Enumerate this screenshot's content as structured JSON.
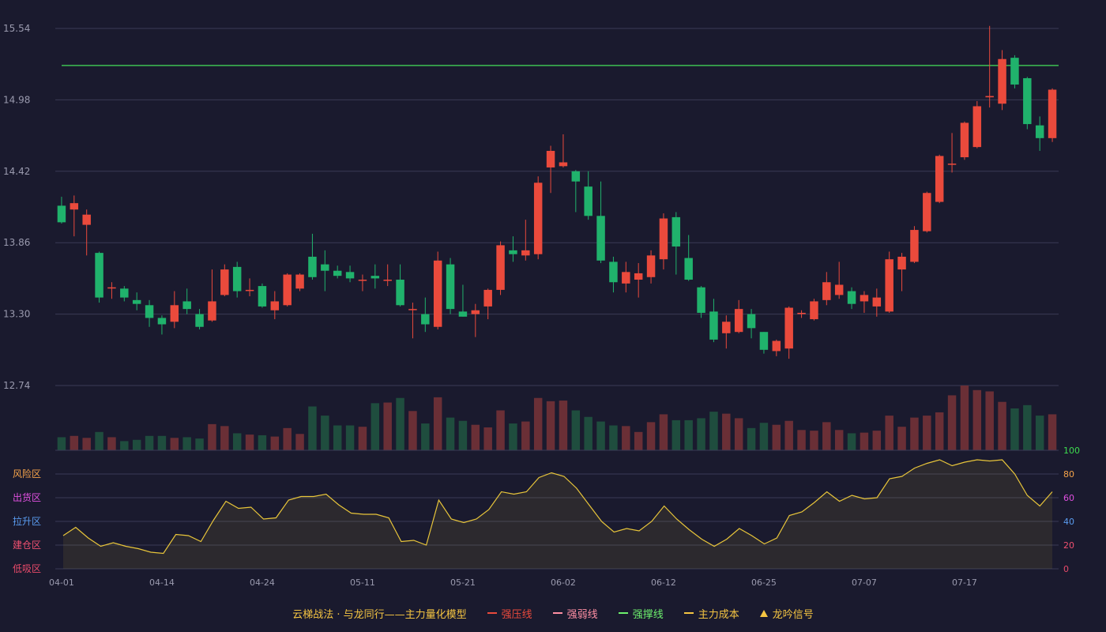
{
  "chart_data": {
    "type": "candlestick",
    "price_axis": {
      "ylim": [
        12.74,
        15.54
      ],
      "ticks": [
        "15.54",
        "14.98",
        "14.42",
        "13.86",
        "13.30",
        "12.74"
      ]
    },
    "reference_line": {
      "value": 15.25,
      "color": "#3cbf52"
    },
    "x_ticks": [
      {
        "i": 0,
        "label": "04-01"
      },
      {
        "i": 8,
        "label": "04-14"
      },
      {
        "i": 16,
        "label": "04-24"
      },
      {
        "i": 24,
        "label": "05-11"
      },
      {
        "i": 32,
        "label": "05-21"
      },
      {
        "i": 40,
        "label": "06-02"
      },
      {
        "i": 48,
        "label": "06-12"
      },
      {
        "i": 56,
        "label": "06-25"
      },
      {
        "i": 64,
        "label": "07-07"
      },
      {
        "i": 72,
        "label": "07-17"
      }
    ],
    "candles": [
      [
        14.15,
        14.02,
        14.22,
        14.01
      ],
      [
        14.12,
        14.17,
        14.23,
        13.91
      ],
      [
        14.0,
        14.08,
        14.12,
        13.76
      ],
      [
        13.78,
        13.43,
        13.79,
        13.39
      ],
      [
        13.51,
        13.51,
        13.55,
        13.42
      ],
      [
        13.5,
        13.43,
        13.52,
        13.4
      ],
      [
        13.41,
        13.38,
        13.47,
        13.33
      ],
      [
        13.37,
        13.27,
        13.41,
        13.2
      ],
      [
        13.27,
        13.22,
        13.29,
        13.14
      ],
      [
        13.24,
        13.37,
        13.48,
        13.19
      ],
      [
        13.4,
        13.34,
        13.5,
        13.3
      ],
      [
        13.3,
        13.2,
        13.34,
        13.18
      ],
      [
        13.25,
        13.4,
        13.65,
        13.24
      ],
      [
        13.45,
        13.65,
        13.69,
        13.44
      ],
      [
        13.67,
        13.48,
        13.71,
        13.43
      ],
      [
        13.49,
        13.49,
        13.58,
        13.44
      ],
      [
        13.52,
        13.36,
        13.54,
        13.35
      ],
      [
        13.33,
        13.4,
        13.48,
        13.26
      ],
      [
        13.37,
        13.61,
        13.62,
        13.36
      ],
      [
        13.5,
        13.61,
        13.62,
        13.48
      ],
      [
        13.75,
        13.59,
        13.93,
        13.57
      ],
      [
        13.69,
        13.64,
        13.8,
        13.48
      ],
      [
        13.64,
        13.6,
        13.68,
        13.58
      ],
      [
        13.63,
        13.58,
        13.68,
        13.55
      ],
      [
        13.57,
        13.57,
        13.61,
        13.48
      ],
      [
        13.6,
        13.58,
        13.69,
        13.5
      ],
      [
        13.57,
        13.57,
        13.69,
        13.52
      ],
      [
        13.57,
        13.37,
        13.69,
        13.36
      ],
      [
        13.34,
        13.34,
        13.39,
        13.11
      ],
      [
        13.3,
        13.22,
        13.43,
        13.16
      ],
      [
        13.2,
        13.72,
        13.79,
        13.18
      ],
      [
        13.69,
        13.34,
        13.74,
        13.3
      ],
      [
        13.32,
        13.28,
        13.53,
        13.28
      ],
      [
        13.3,
        13.33,
        13.38,
        13.12
      ],
      [
        13.36,
        13.49,
        13.5,
        13.26
      ],
      [
        13.49,
        13.84,
        13.87,
        13.45
      ],
      [
        13.8,
        13.77,
        13.91,
        13.71
      ],
      [
        13.76,
        13.8,
        14.04,
        13.72
      ],
      [
        13.77,
        14.33,
        14.38,
        13.73
      ],
      [
        14.45,
        14.58,
        14.62,
        14.25
      ],
      [
        14.46,
        14.49,
        14.71,
        14.45
      ],
      [
        14.42,
        14.34,
        14.43,
        14.1
      ],
      [
        14.3,
        14.07,
        14.42,
        14.04
      ],
      [
        14.07,
        13.72,
        14.34,
        13.7
      ],
      [
        13.71,
        13.55,
        13.75,
        13.47
      ],
      [
        13.54,
        13.63,
        13.71,
        13.47
      ],
      [
        13.57,
        13.62,
        13.7,
        13.43
      ],
      [
        13.59,
        13.76,
        13.8,
        13.54
      ],
      [
        13.73,
        14.05,
        14.09,
        13.65
      ],
      [
        14.06,
        13.83,
        14.1,
        13.61
      ],
      [
        13.74,
        13.57,
        13.92,
        13.56
      ],
      [
        13.51,
        13.31,
        13.52,
        13.27
      ],
      [
        13.32,
        13.1,
        13.42,
        13.08
      ],
      [
        13.15,
        13.24,
        13.29,
        13.03
      ],
      [
        13.16,
        13.34,
        13.41,
        13.15
      ],
      [
        13.3,
        13.19,
        13.34,
        13.11
      ],
      [
        13.16,
        13.02,
        13.16,
        12.99
      ],
      [
        13.01,
        13.09,
        13.1,
        12.97
      ],
      [
        13.03,
        13.35,
        13.36,
        12.95
      ],
      [
        13.3,
        13.31,
        13.33,
        13.27
      ],
      [
        13.26,
        13.4,
        13.42,
        13.25
      ],
      [
        13.41,
        13.55,
        13.63,
        13.37
      ],
      [
        13.45,
        13.53,
        13.71,
        13.42
      ],
      [
        13.48,
        13.38,
        13.51,
        13.34
      ],
      [
        13.4,
        13.45,
        13.48,
        13.31
      ],
      [
        13.36,
        13.43,
        13.5,
        13.28
      ],
      [
        13.32,
        13.73,
        13.79,
        13.31
      ],
      [
        13.65,
        13.75,
        13.78,
        13.48
      ],
      [
        13.71,
        13.96,
        13.99,
        13.7
      ],
      [
        13.95,
        14.25,
        14.26,
        13.94
      ],
      [
        14.18,
        14.54,
        14.55,
        14.17
      ],
      [
        14.48,
        14.48,
        14.72,
        14.41
      ],
      [
        14.53,
        14.8,
        14.81,
        14.51
      ],
      [
        14.61,
        14.93,
        14.97,
        14.6
      ],
      [
        15.0,
        15.01,
        15.56,
        14.92
      ],
      [
        14.95,
        15.3,
        15.37,
        14.9
      ],
      [
        15.31,
        15.1,
        15.33,
        15.07
      ],
      [
        15.15,
        14.79,
        15.16,
        14.75
      ],
      [
        14.78,
        14.68,
        14.85,
        14.58
      ],
      [
        14.68,
        15.06,
        15.07,
        14.65
      ]
    ],
    "volume": [
      10,
      11,
      9.5,
      14,
      10,
      7,
      8,
      11,
      11,
      9.5,
      10,
      9,
      20,
      18.5,
      13,
      12,
      11.5,
      10.5,
      17,
      12.5,
      33.5,
      26.5,
      19,
      19,
      18,
      36,
      36.5,
      40,
      30,
      20.5,
      40.5,
      25,
      22.5,
      19.5,
      17.5,
      30.5,
      20.5,
      22,
      40,
      37.5,
      38,
      30.5,
      25.5,
      22,
      19,
      18.5,
      14,
      21.5,
      27.5,
      23,
      23,
      24.5,
      29.5,
      28,
      24.5,
      17,
      21,
      19.5,
      22.5,
      15.5,
      15,
      21.5,
      15.5,
      13,
      13.5,
      15,
      26.5,
      18,
      25,
      26.5,
      29,
      42,
      49.5,
      46,
      45,
      37,
      32,
      34.5,
      26.5,
      27.5
    ],
    "oscillator": {
      "ylim": [
        0,
        100
      ],
      "ticks": [
        "100",
        "80",
        "60",
        "40",
        "20",
        "0"
      ],
      "zones": [
        "风险区",
        "出货区",
        "拉升区",
        "建仓区",
        "低吸区"
      ],
      "values": [
        28,
        35,
        26,
        19,
        22,
        19,
        17,
        14,
        13,
        29,
        28,
        23,
        41,
        57,
        51,
        52,
        42,
        43,
        58,
        61,
        61,
        63,
        54,
        47,
        46,
        46,
        43,
        23,
        24,
        20,
        58,
        42,
        39,
        42,
        50,
        65,
        63,
        65,
        77,
        81,
        78,
        68,
        54,
        40,
        31,
        34,
        32,
        40,
        53,
        42,
        33,
        25,
        19,
        25,
        34,
        28,
        21,
        26,
        45,
        48,
        56,
        65,
        57,
        62,
        59,
        60,
        76,
        78,
        85,
        89,
        92,
        87,
        90,
        92,
        91,
        92,
        80,
        62,
        53,
        65
      ]
    },
    "colors": {
      "up": "#ea4a3c",
      "down": "#20b26c",
      "up_volume": "#6a2f36",
      "down_volume": "#1f4d3e",
      "oscillator_line": "#e8c53a",
      "zone_risk": "#f5a34a",
      "zone_distribution": "#e050e0",
      "zone_rally": "#5a9cf0",
      "zone_build": "#f05070",
      "zone_dip": "#e84a6a"
    }
  },
  "legend": {
    "title": "云梯战法 · 与龙同行——主力量化模型",
    "items": [
      {
        "label": "强压线",
        "color": "#ea4a3c",
        "style": "solid"
      },
      {
        "label": "强弱线",
        "color": "#ff8fa3",
        "style": "dash"
      },
      {
        "label": "强撑线",
        "color": "#6df06d",
        "style": "solid"
      },
      {
        "label": "主力成本",
        "color": "#f5c542",
        "style": "dash"
      },
      {
        "label": "龙吟信号",
        "color": "#f5c542",
        "style": "triangle"
      }
    ]
  }
}
